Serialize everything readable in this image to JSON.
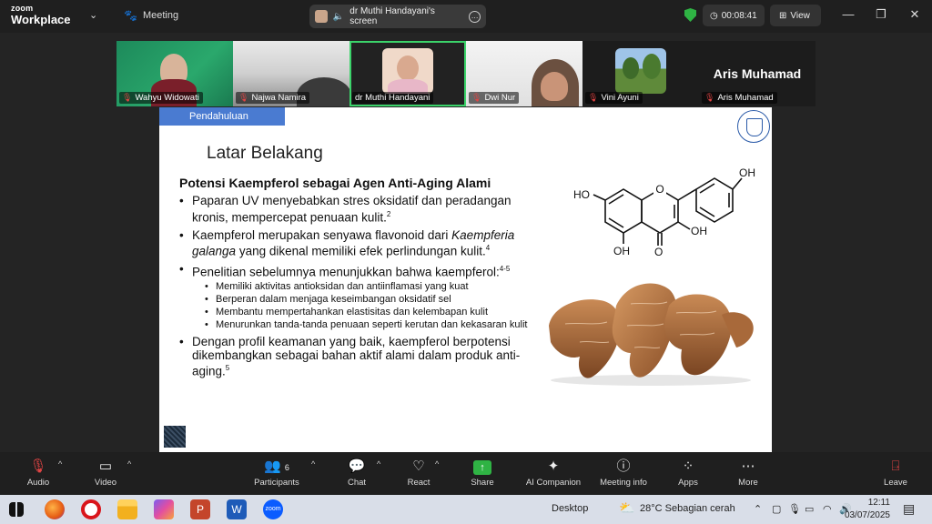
{
  "titlebar": {
    "brand_top": "zoom",
    "brand_bottom": "Workplace",
    "meeting_tab": "Meeting",
    "share_label": "dr Muthi Handayani's screen",
    "timer": "00:08:41",
    "view_label": "View",
    "window_controls": [
      "minimize-icon",
      "restore-icon",
      "close-icon"
    ]
  },
  "participants": [
    {
      "name": "Wahyu Widowati",
      "muted": true
    },
    {
      "name": "Najwa Namira",
      "muted": true
    },
    {
      "name": "dr Muthi Handayani",
      "muted": false,
      "active": true
    },
    {
      "name": "Dwi Nur",
      "muted": true
    },
    {
      "name": "Vini Ayuni",
      "muted": true
    },
    {
      "name": "Aris Muhamad",
      "muted": true,
      "display_name": "Aris Muhamad"
    }
  ],
  "slide": {
    "section": "Pendahuluan",
    "title": "Latar Belakang",
    "subtitle": "Potensi Kaempferol sebagai Agen Anti-Aging Alami",
    "b1_text": "Paparan UV menyebabkan stres oksidatif dan peradangan kronis, mempercepat penuaan kulit.",
    "b1_ref": "2",
    "b2_pre": "Kaempferol merupakan senyawa flavonoid dari ",
    "b2_italic": "Kaempferia galanga",
    "b2_post": " yang dikenal memiliki efek perlindungan kulit.",
    "b2_ref": "4",
    "b3_text": "Penelitian sebelumnya menunjukkan bahwa kaempferol:",
    "b3_ref": "4-5",
    "sub_bullets": [
      "Memiliki aktivitas antioksidan dan antiinflamasi yang kuat",
      "Berperan dalam menjaga keseimbangan oksidatif sel",
      "Membantu mempertahankan elastisitas dan kelembapan kulit",
      "Menurunkan tanda-tanda penuaan seperti kerutan dan kekasaran kulit"
    ],
    "b4_text": "Dengan profil keamanan yang baik, kaempferol berpotensi dikembangkan sebagai bahan aktif alami dalam produk anti-aging.",
    "b4_ref": "5",
    "molecule_labels": {
      "oh_top": "OH",
      "ho_left": "HO",
      "o_ring": "O",
      "oh_right": "OH",
      "oh_bottom": "OH",
      "o_bottom": "O"
    }
  },
  "toolbar": {
    "audio": "Audio",
    "video": "Video",
    "participants": "Participants",
    "participants_count": "6",
    "chat": "Chat",
    "react": "React",
    "share": "Share",
    "ai_companion": "AI Companion",
    "meeting_info": "Meeting info",
    "apps": "Apps",
    "more": "More",
    "leave": "Leave"
  },
  "taskbar": {
    "desktop": "Desktop",
    "weather": "28°C  Sebagian cerah",
    "time": "12:11",
    "date": "03/07/2025"
  }
}
